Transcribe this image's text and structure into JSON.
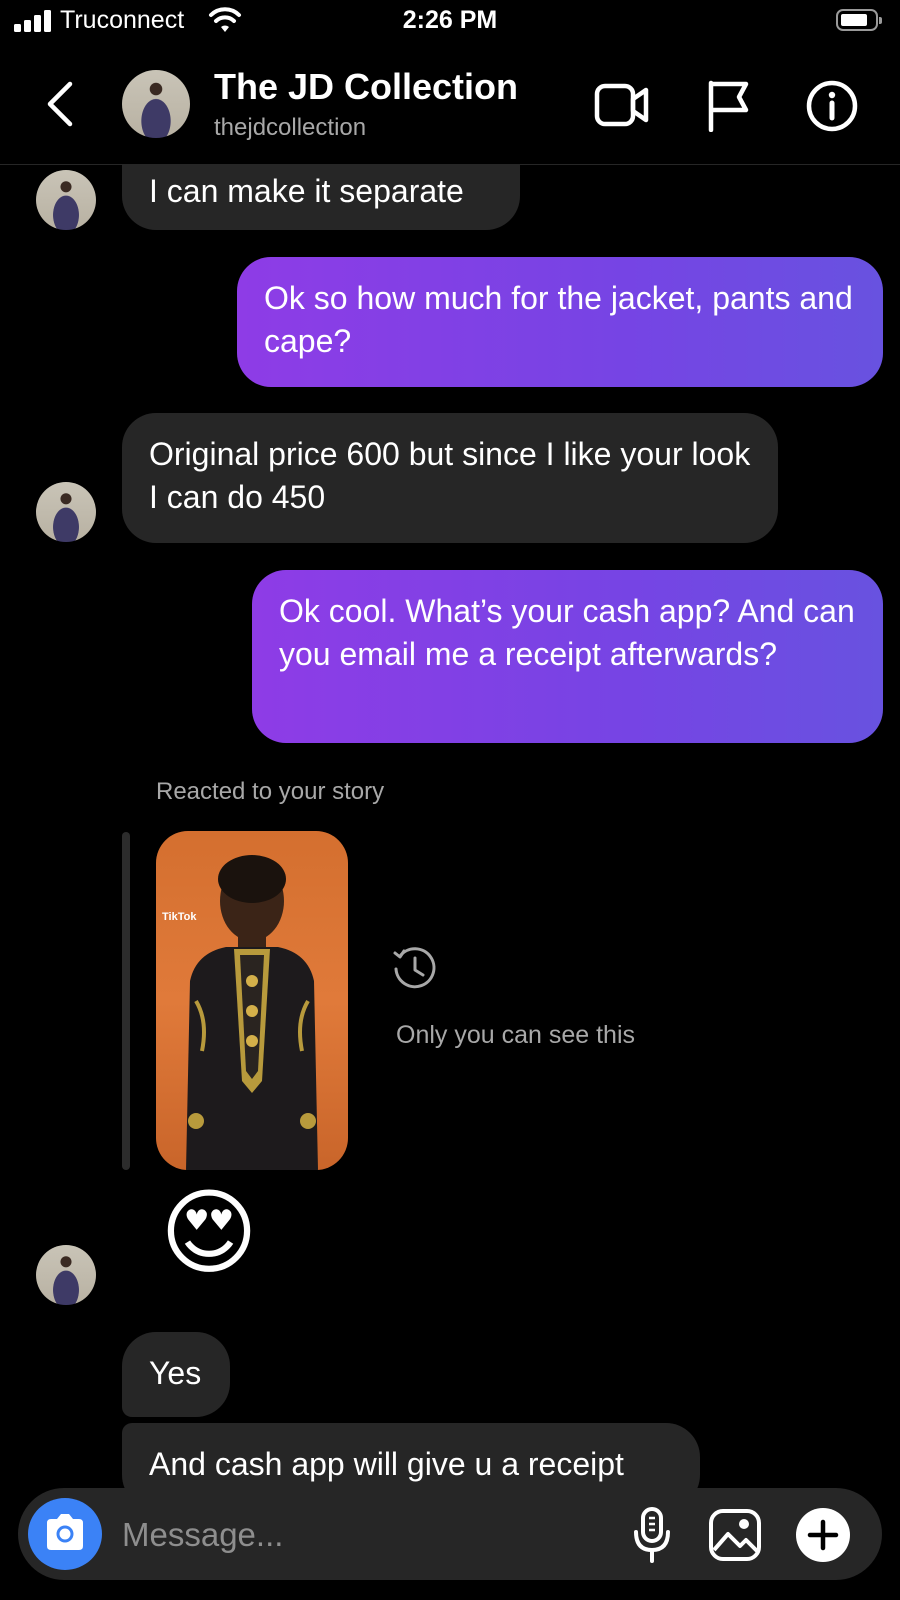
{
  "status_bar": {
    "carrier": "Truconnect",
    "time": "2:26 PM"
  },
  "header": {
    "title": "The JD Collection",
    "username": "thejdcollection",
    "icons": [
      "back-icon",
      "video-call-icon",
      "flag-icon",
      "info-icon"
    ]
  },
  "messages": [
    {
      "side": "in",
      "text": "I can make it separate"
    },
    {
      "side": "out",
      "text": "Ok so how much for the jacket, pants and cape?"
    },
    {
      "side": "in",
      "text": "Original price 600 but since I like your look I can do 450"
    },
    {
      "side": "out",
      "text": "Ok cool. What’s your cash app? And can you email me a receipt afterwards?"
    },
    {
      "side": "in",
      "text": "Yes"
    },
    {
      "side": "in",
      "text": "And cash app will give u a receipt"
    }
  ],
  "story_reaction": {
    "label": "Reacted to your story",
    "reaction_emoji": "😍",
    "note": "Only you can see this",
    "watermark_brand": "TikTok"
  },
  "composer": {
    "placeholder": "Message..."
  },
  "colors": {
    "outgoing_start": "#8e3ce6",
    "outgoing_end": "#6852e0",
    "incoming": "#262626",
    "camera_button": "#3b82f6"
  }
}
